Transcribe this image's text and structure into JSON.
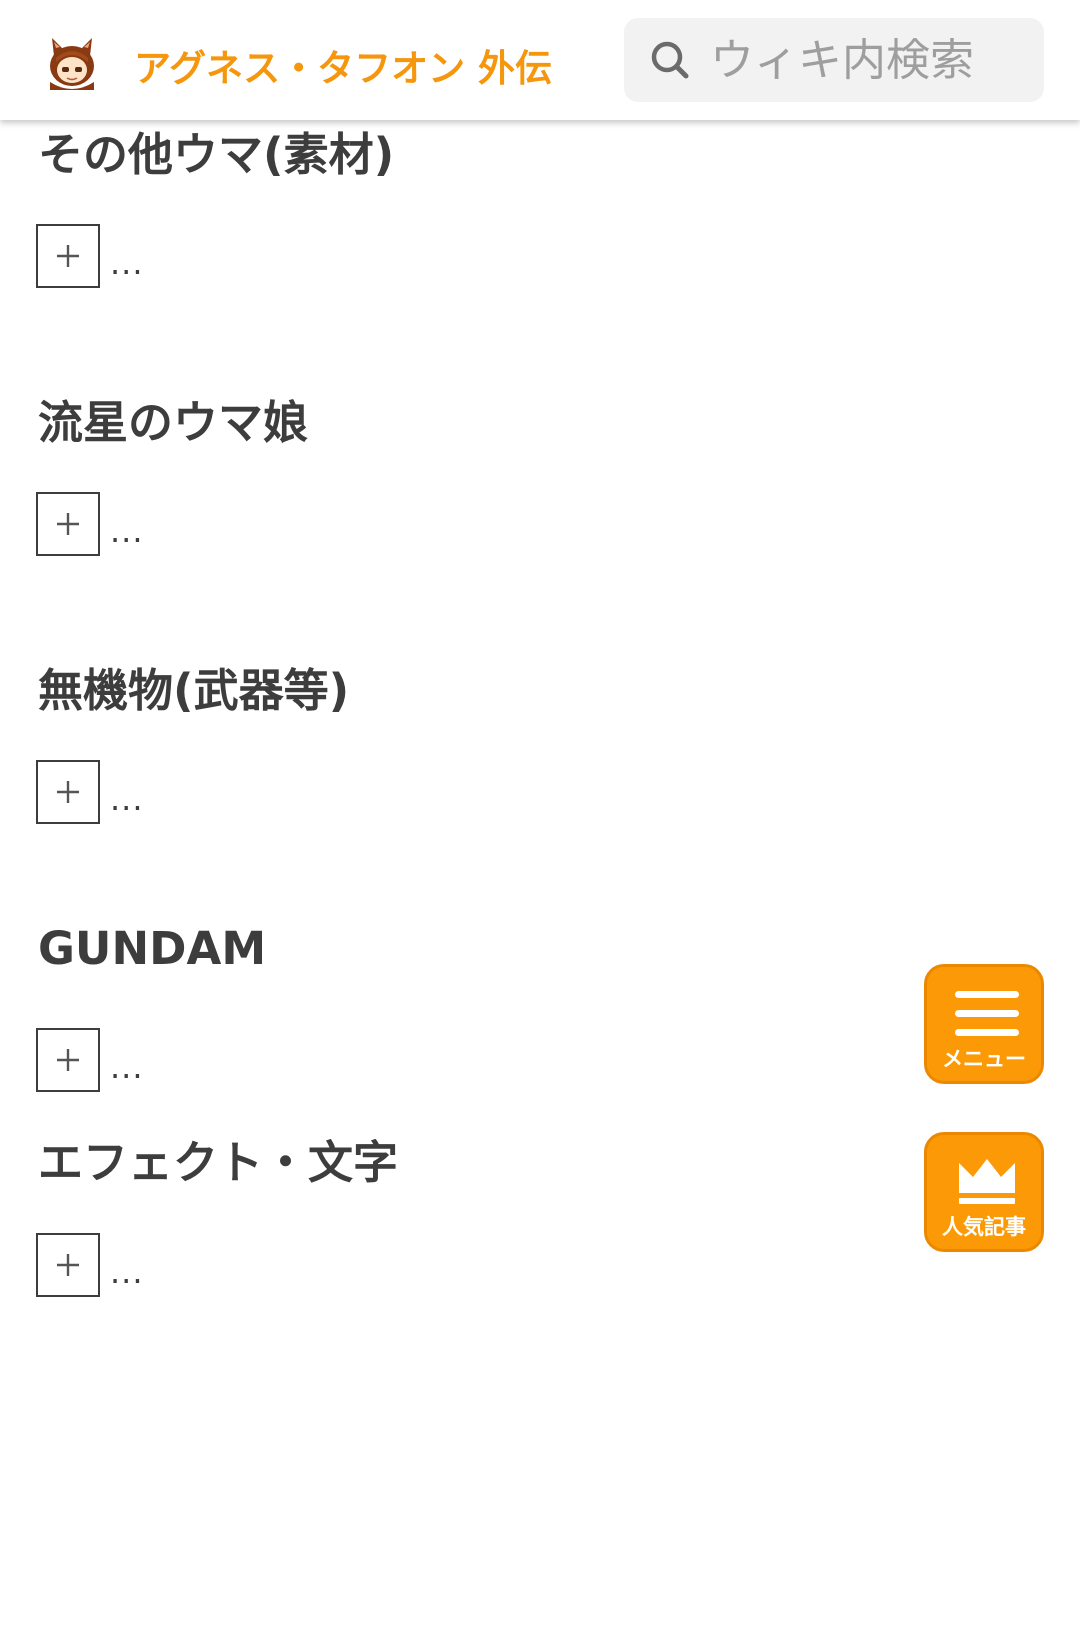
{
  "header": {
    "site_title": "アグネス・タフオン 外伝",
    "logo_icon": "chibi-horse-girl-logo-icon",
    "search_placeholder": "ウィキ内検索",
    "search_icon": "search-icon"
  },
  "sections": [
    {
      "title": "その他ウマ(素材)",
      "ellipsis": "..."
    },
    {
      "title": "流星のウマ娘",
      "ellipsis": "..."
    },
    {
      "title": "無機物(武器等)",
      "ellipsis": "..."
    },
    {
      "title": "GUNDAM",
      "ellipsis": "..."
    },
    {
      "title": "エフェクト・文字",
      "ellipsis": "..."
    }
  ],
  "floating_buttons": {
    "menu": {
      "label": "メニュー",
      "icon": "hamburger-menu-icon"
    },
    "popular": {
      "label": "人気記事",
      "icon": "crown-icon"
    }
  },
  "colors": {
    "accent": "#f5960c",
    "fab_background": "#fb9a06",
    "text": "#3d3d3d",
    "search_background": "#f2f2f2"
  }
}
